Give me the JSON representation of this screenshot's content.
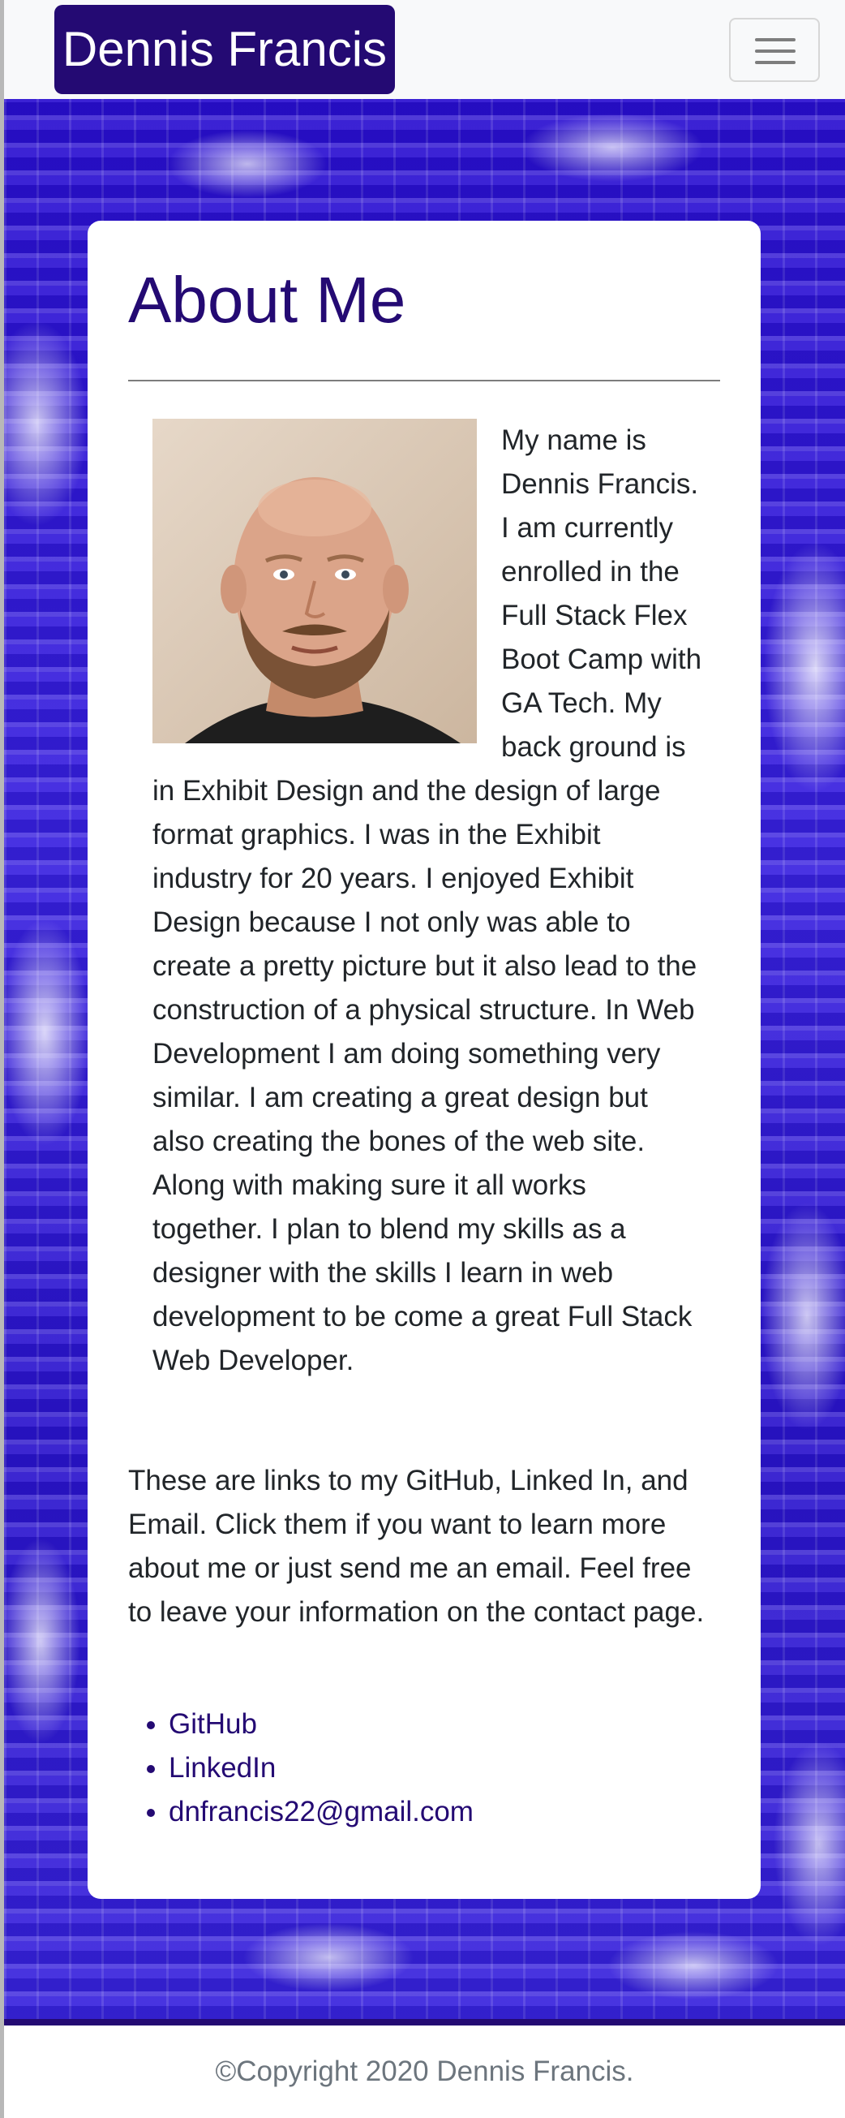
{
  "navbar": {
    "brand": "Dennis Francis",
    "toggler_icon": "hamburger-icon"
  },
  "about": {
    "title": "About Me",
    "portrait_alt": "Dennis Francis portrait",
    "bio": "My name is Dennis Francis. I am currently enrolled in the Full Stack Flex Boot Camp with GA Tech. My back ground is in Exhibit Design and the design of large format graphics. I was in the Exhibit industry for 20 years. I enjoyed Exhibit Design because I not only was able to create a pretty picture but it also lead to the construction of a physical structure. In Web Development I am doing something very similar. I am creating a great design but also creating the bones of the web site. Along with making sure it all works together. I plan to blend my skills as a designer with the skills I learn in web development to be come a great Full Stack Web Developer.",
    "links_text": "These are links to my GitHub, Linked In, and Email. Click them if you want to learn more about me or just send me an email. Feel free to leave your information on the contact page.",
    "links": [
      {
        "label": "GitHub"
      },
      {
        "label": "LinkedIn"
      },
      {
        "label": "dnfrancis22@gmail.com"
      }
    ]
  },
  "footer": {
    "copyright": "©Copyright 2020 Dennis Francis."
  },
  "colors": {
    "brand": "#240a73",
    "background_blue": "#2a0fd0",
    "text": "#212529",
    "footer_text": "#6c757d"
  }
}
